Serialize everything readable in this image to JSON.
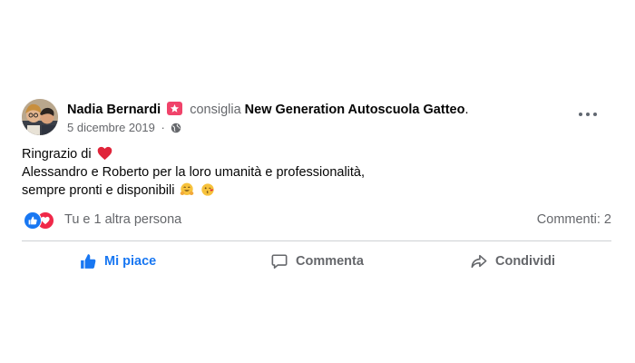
{
  "post": {
    "author": "Nadia Bernardi",
    "verb": "consiglia",
    "page": "New Generation Autoscuola Gatteo",
    "period": ".",
    "date": "5 dicembre 2019",
    "separator": "·",
    "audience_icon": "globe-icon",
    "body": {
      "line1": "Ringrazio di",
      "line2": "Alessandro e Roberto per la loro umanità e professionalità,",
      "line3": "sempre pronti e disponibili"
    }
  },
  "reactions": {
    "summary": "Tu e 1 altra persona",
    "comments": "Commenti: 2",
    "types": [
      "like",
      "love"
    ]
  },
  "actions": {
    "like_label": "Mi piace",
    "comment_label": "Commenta",
    "share_label": "Condividi"
  },
  "colors": {
    "primary_blue": "#1877f2",
    "secondary_text": "#65676b",
    "love_red": "#f02849",
    "recommend_pink": "#f0436a"
  }
}
